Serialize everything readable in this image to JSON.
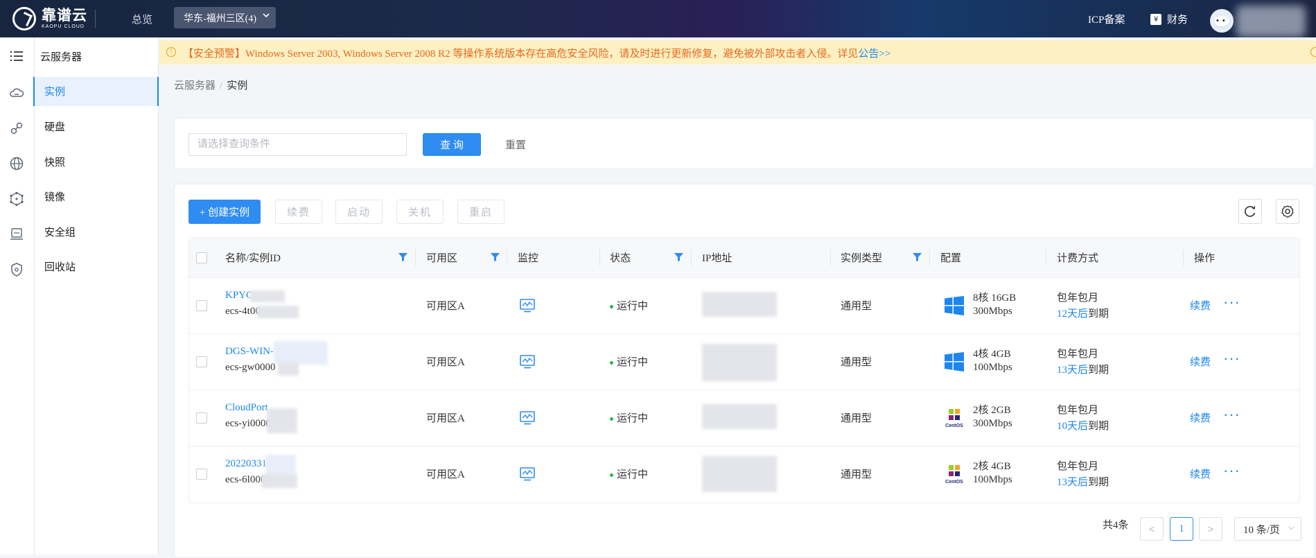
{
  "brand": {
    "name": "靠谱云",
    "sub": "KAOPU CLOUD"
  },
  "topnav": {
    "overview": "总览",
    "region": "华东-福州三区(4)",
    "icp": "ICP备案",
    "finance": "财务"
  },
  "sidebar": {
    "title": "云服务器",
    "items": [
      {
        "label": "实例",
        "icon": "cloud-icon"
      },
      {
        "label": "硬盘",
        "icon": "disk-icon"
      },
      {
        "label": "快照",
        "icon": "globe-icon"
      },
      {
        "label": "镜像",
        "icon": "network-icon"
      },
      {
        "label": "安全组",
        "icon": "security-group-icon"
      },
      {
        "label": "回收站",
        "icon": "shield-icon"
      }
    ]
  },
  "alert": {
    "text": "【安全预警】Windows Server 2003, Windows Server 2008 R2 等操作系统版本存在高危安全风险，请及时进行更新修复，避免被外部攻击者入侵。详见",
    "link": "公告>>"
  },
  "breadcrumb": {
    "root": "云服务器",
    "sep": "/",
    "current": "实例"
  },
  "search": {
    "placeholder": "请选择查询条件",
    "query": "查 询",
    "reset": "重置"
  },
  "toolbar": {
    "create": "+ 创建实例",
    "renew": "续费",
    "start": "启动",
    "shutdown": "关机",
    "restart": "重启"
  },
  "table": {
    "headers": {
      "name": "名称/实例ID",
      "zone": "可用区",
      "monitor": "监控",
      "status": "状态",
      "ip": "IP地址",
      "type": "实例类型",
      "config": "配置",
      "billing": "计费方式",
      "actions": "操作"
    },
    "rows": [
      {
        "name": "KPYC",
        "id": "ecs-4t00",
        "zone": "可用区A",
        "status": "运行中",
        "type": "通用型",
        "os": "windows",
        "cpu_mem": "8核 16GB",
        "bandwidth": "300Mbps",
        "billing": "包年包月",
        "days": "12天后",
        "expire": "到期",
        "renew": "续费"
      },
      {
        "name": "DGS-WIN-",
        "id": "ecs-gw0000",
        "zone": "可用区A",
        "status": "运行中",
        "type": "通用型",
        "os": "windows",
        "cpu_mem": "4核 4GB",
        "bandwidth": "100Mbps",
        "billing": "包年包月",
        "days": "13天后",
        "expire": "到期",
        "renew": "续费"
      },
      {
        "name": "CloudPort",
        "id": "ecs-yi0000",
        "zone": "可用区A",
        "status": "运行中",
        "type": "通用型",
        "os": "centos",
        "cpu_mem": "2核 2GB",
        "bandwidth": "300Mbps",
        "billing": "包年包月",
        "days": "10天后",
        "expire": "到期",
        "renew": "续费"
      },
      {
        "name": "202203311",
        "id": "ecs-6l0000",
        "zone": "可用区A",
        "status": "运行中",
        "type": "通用型",
        "os": "centos",
        "cpu_mem": "2核 4GB",
        "bandwidth": "100Mbps",
        "billing": "包年包月",
        "days": "13天后",
        "expire": "到期",
        "renew": "续费"
      }
    ]
  },
  "pagination": {
    "total": "共4条",
    "current": "1",
    "page_size": "10 条/页"
  },
  "colors": {
    "primary": "#2f8cf1",
    "link": "#1c86ee",
    "running": "#2cb84a",
    "alert_bg": "#fdf0c3",
    "alert_text": "#e76a1e"
  }
}
